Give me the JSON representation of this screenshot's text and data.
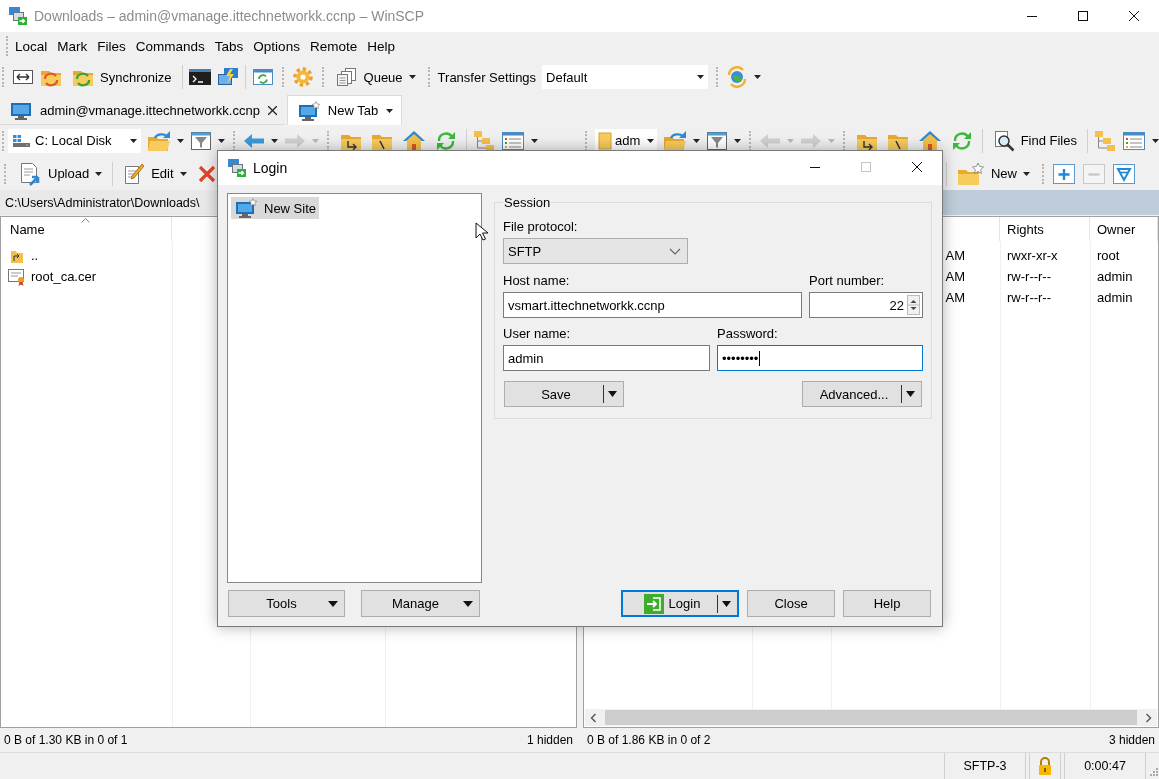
{
  "window": {
    "title": "Downloads – admin@vmanage.ittechnetworkk.ccnp – WinSCP"
  },
  "menu": [
    "Local",
    "Mark",
    "Files",
    "Commands",
    "Tabs",
    "Options",
    "Remote",
    "Help"
  ],
  "toolbar": {
    "synchronize": "Synchronize",
    "queue": "Queue",
    "transfer_settings": "Transfer Settings",
    "preset": "Default"
  },
  "tabs": [
    {
      "label": "admin@vmanage.ittechnetworkk.ccnp",
      "kind": "session",
      "selected": false
    },
    {
      "label": "New Tab",
      "kind": "new",
      "selected": true
    }
  ],
  "local_panel": {
    "location": "C: Local Disk",
    "back_enabled": true,
    "forward_enabled": false,
    "upload": "Upload",
    "edit": "Edit",
    "active": false,
    "path": "C:\\Users\\Administrator\\Downloads\\",
    "columns": [
      {
        "label": "Name",
        "sorted": true
      }
    ],
    "files": [
      {
        "name": "..",
        "kind": "parent"
      },
      {
        "name": "root_ca.cer",
        "kind": "file"
      }
    ],
    "status": "0 B of 1.30 KB in 0 of 1",
    "hidden": "1 hidden"
  },
  "remote_panel": {
    "location": "adm",
    "back_enabled": false,
    "forward_enabled": false,
    "find_files": "Find Files",
    "new": "New",
    "remove_enabled": false,
    "active": true,
    "columns": [
      "Rights",
      "Owner"
    ],
    "files": [
      {
        "cells": [
          "AM",
          "rwxr-xr-x",
          "root"
        ]
      },
      {
        "cells": [
          "AM",
          "rw-r--r--",
          "admin"
        ]
      },
      {
        "cells": [
          "AM",
          "rw-r--r--",
          "admin"
        ]
      }
    ],
    "status": "0 B of 1.86 KB in 0 of 2",
    "hidden": "3 hidden"
  },
  "status_bar": {
    "protocol": "SFTP-3",
    "elapsed": "0:00:47"
  },
  "login_dialog": {
    "title": "Login",
    "maximize_enabled": false,
    "sites": [
      {
        "label": "New Site",
        "selected": true
      }
    ],
    "session": {
      "legend": "Session",
      "file_protocol": {
        "label": "File protocol:",
        "value": "SFTP"
      },
      "host_name": {
        "label": "Host name:",
        "value": "vsmart.ittechnetworkk.ccnp"
      },
      "port_number": {
        "label": "Port number:",
        "value": "22"
      },
      "user_name": {
        "label": "User name:",
        "value": "admin"
      },
      "password": {
        "label": "Password:",
        "value": "••••••••",
        "focused": true
      },
      "save": "Save",
      "advanced": "Advanced..."
    },
    "tree_buttons": [
      {
        "label": "Tools",
        "kind": "dropdown",
        "default": false
      },
      {
        "label": "Manage",
        "kind": "dropdown",
        "default": false
      }
    ],
    "buttons": [
      {
        "label": "Login",
        "kind": "action",
        "default": true
      },
      {
        "label": "Close",
        "kind": "plain",
        "default": false
      },
      {
        "label": "Help",
        "kind": "plain",
        "default": false
      }
    ]
  }
}
